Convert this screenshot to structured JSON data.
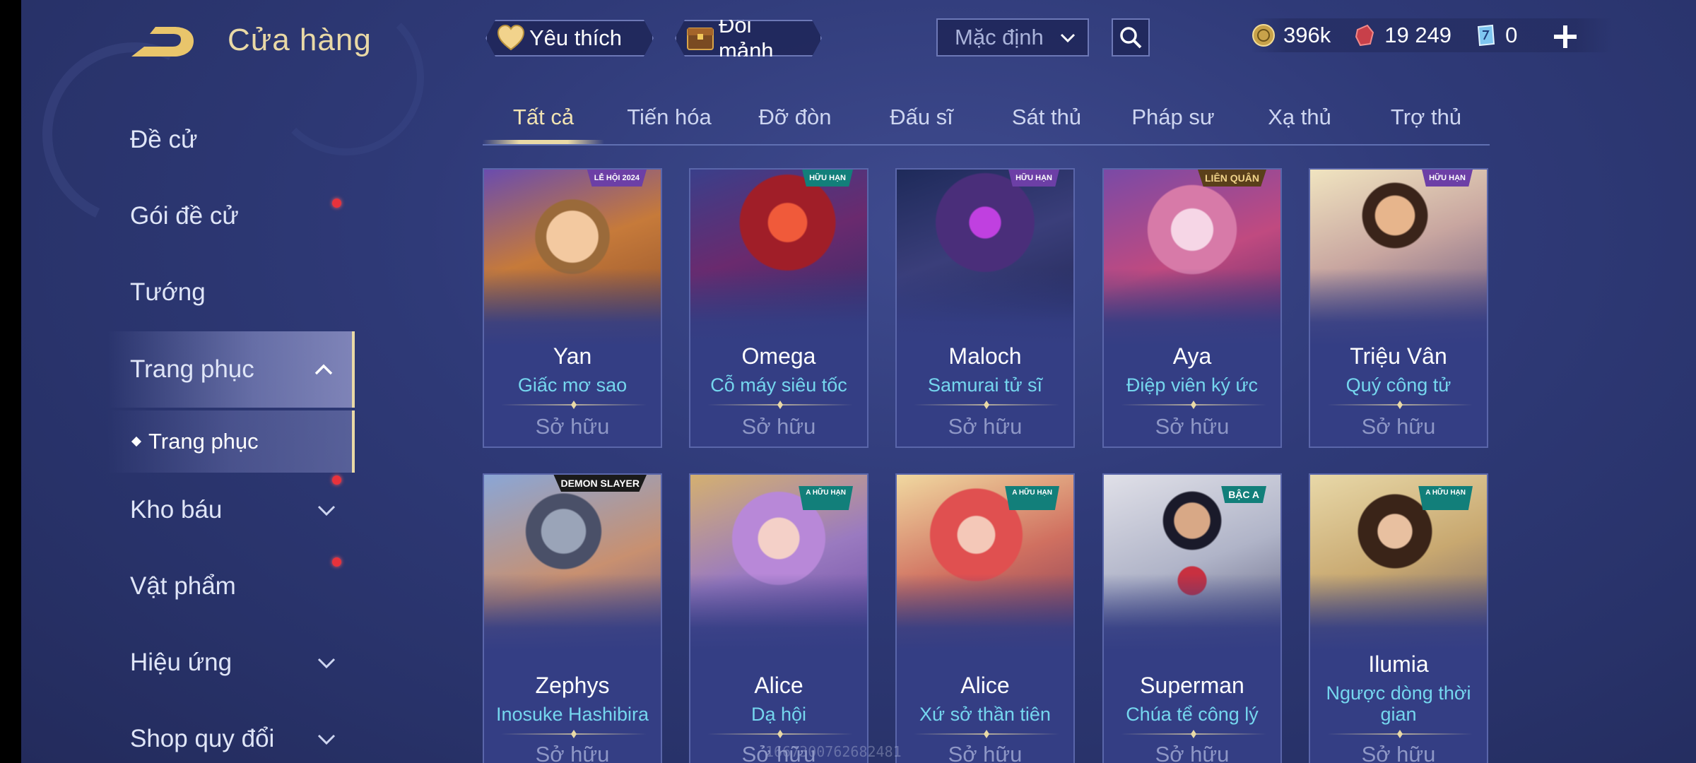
{
  "header": {
    "title": "Cửa hàng",
    "favorite_label": "Yêu thích",
    "shard_exchange_label": "Đổi mảnh",
    "sort_value": "Mặc định"
  },
  "currencies": [
    {
      "icon": "gold-coin-icon",
      "value": "396k"
    },
    {
      "icon": "ruby-gem-icon",
      "value": "19 249"
    },
    {
      "icon": "voucher-icon",
      "value": "0"
    }
  ],
  "sidebar": {
    "items": [
      {
        "label": "Đề cử"
      },
      {
        "label": "Gói đề cử"
      },
      {
        "label": "Tướng"
      },
      {
        "label": "Trang phục"
      },
      {
        "label": "Kho báu"
      },
      {
        "label": "Vật phẩm"
      },
      {
        "label": "Hiệu ứng"
      },
      {
        "label": "Shop quy đổi"
      }
    ],
    "sub_item": "Trang phục"
  },
  "tabs": [
    "Tất cả",
    "Tiến hóa",
    "Đỡ đòn",
    "Đấu sĩ",
    "Sát thủ",
    "Pháp sư",
    "Xạ thủ",
    "Trợ thủ"
  ],
  "active_tab": "Tất cả",
  "skins": [
    {
      "hero": "Yan",
      "skin": "Giấc mơ sao",
      "status": "Sở hữu",
      "badge": "LỄ HỘI 2024"
    },
    {
      "hero": "Omega",
      "skin": "Cỗ máy siêu tốc",
      "status": "Sở hữu",
      "badge": "HỮU HẠN"
    },
    {
      "hero": "Maloch",
      "skin": "Samurai tử sĩ",
      "status": "Sở hữu",
      "badge": "HỮU HẠN"
    },
    {
      "hero": "Aya",
      "skin": "Điệp viên ký ức",
      "status": "Sở hữu",
      "badge": "LIÊN QUÂN"
    },
    {
      "hero": "Triệu Vân",
      "skin": "Quý công tử",
      "status": "Sở hữu",
      "badge": "HỮU HẠN"
    },
    {
      "hero": "Zephys",
      "skin": "Inosuke Hashibira",
      "status": "Sở hữu",
      "badge": "DEMON SLAYER"
    },
    {
      "hero": "Alice",
      "skin": "Dạ hội",
      "status": "Sở hữu",
      "badge": "A HỮU HẠN"
    },
    {
      "hero": "Alice",
      "skin": "Xứ sở thần tiên",
      "status": "Sở hữu",
      "badge": "A HỮU HẠN"
    },
    {
      "hero": "Superman",
      "skin": "Chúa tể công lý",
      "status": "Sở hữu",
      "badge": "BẬC A"
    },
    {
      "hero": "Ilumia",
      "skin": "Ngược dòng thời gian",
      "status": "Sở hữu",
      "badge": "A HỮU HẠN"
    }
  ],
  "watermark": "1667300762682481",
  "colors": {
    "accent_gold": "#e9d9a6",
    "skin_name": "#75d6ee",
    "notification": "#e8323c",
    "background": "#2f3a78"
  }
}
